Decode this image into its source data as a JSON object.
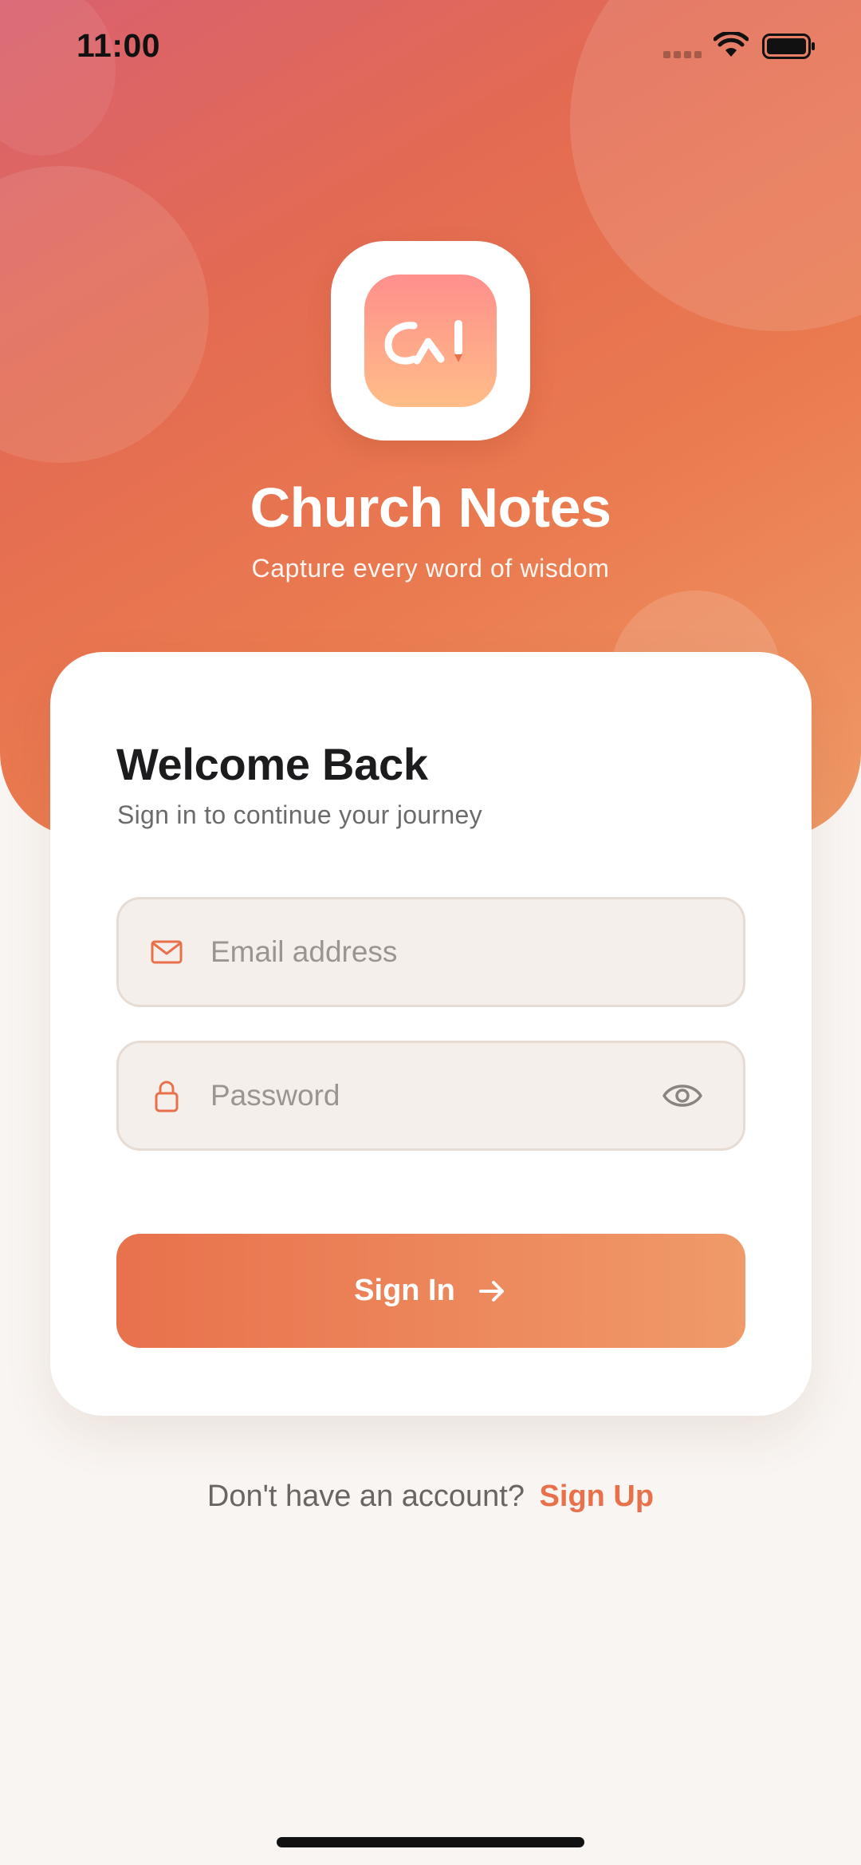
{
  "status_bar": {
    "time": "11:00",
    "icons": [
      "signal-icon",
      "wifi-icon",
      "battery-icon"
    ]
  },
  "hero": {
    "logo_icon": "app-logo-icon",
    "app_name": "Church Notes",
    "tagline": "Capture every word of wisdom"
  },
  "login_card": {
    "title": "Welcome Back",
    "subtitle": "Sign in to continue your journey",
    "email_field": {
      "placeholder": "Email address",
      "value": "",
      "icon": "mail-icon"
    },
    "password_field": {
      "placeholder": "Password",
      "value": "",
      "icon": "lock-icon",
      "toggle_icon": "eye-icon"
    },
    "submit_label": "Sign In",
    "submit_icon": "arrow-right-icon"
  },
  "footer": {
    "prompt": "Don't have an account?",
    "link_label": "Sign Up"
  },
  "colors": {
    "accent": "#e8714c",
    "gradient_start": "#d9616f",
    "gradient_end": "#ef9a66",
    "background": "#f9f5f2",
    "card": "#ffffff",
    "field_background": "#f4efeb"
  }
}
